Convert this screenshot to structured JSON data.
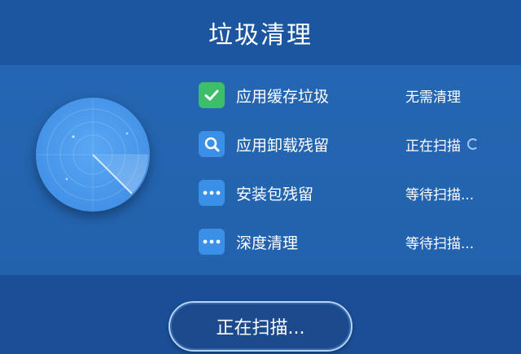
{
  "header": {
    "title": "垃圾清理"
  },
  "items": [
    {
      "label": "应用缓存垃圾",
      "status": "无需清理",
      "icon": "check-icon"
    },
    {
      "label": "应用卸载残留",
      "status": "正在扫描",
      "icon": "search-icon"
    },
    {
      "label": "安装包残留",
      "status": "等待扫描...",
      "icon": "more-icon"
    },
    {
      "label": "深度清理",
      "status": "等待扫描...",
      "icon": "more-icon"
    }
  ],
  "button": {
    "label": "正在扫描..."
  },
  "colors": {
    "background": "#1d5aa3",
    "check": "#3cbe6a",
    "icon_blue": "#3a8fe6",
    "radar": "#4a9aee"
  }
}
